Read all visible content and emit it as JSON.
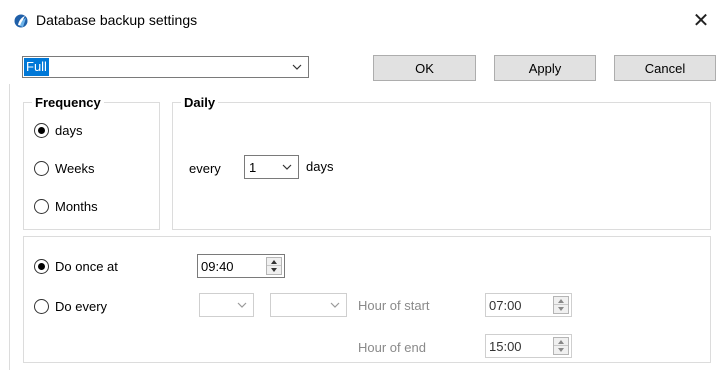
{
  "window": {
    "title": "Database backup settings",
    "app_icon": "app-logo-icon",
    "close_glyph": "✕"
  },
  "backup_type": {
    "selected": "Full"
  },
  "buttons": {
    "ok": "OK",
    "apply": "Apply",
    "cancel": "Cancel"
  },
  "frequency": {
    "title": "Frequency",
    "options": [
      {
        "label": "days",
        "checked": true
      },
      {
        "label": "Weeks",
        "checked": false
      },
      {
        "label": "Months",
        "checked": false
      }
    ]
  },
  "daily": {
    "title": "Daily",
    "every_label": "every",
    "every_value": "1",
    "unit_label": "days"
  },
  "schedule": {
    "do_once_label": "Do once at",
    "do_once_checked": true,
    "do_once_time": "09:40",
    "do_every_label": "Do every",
    "do_every_checked": false,
    "do_every_value": "",
    "do_every_unit": "",
    "hour_of_start_label": "Hour of start",
    "hour_of_start": "07:00",
    "hour_of_end_label": "Hour of end",
    "hour_of_end": "15:00"
  },
  "colors": {
    "selection": "#0078d7",
    "button_bg": "#e1e1e1",
    "disabled_text": "#8a8a8a"
  }
}
